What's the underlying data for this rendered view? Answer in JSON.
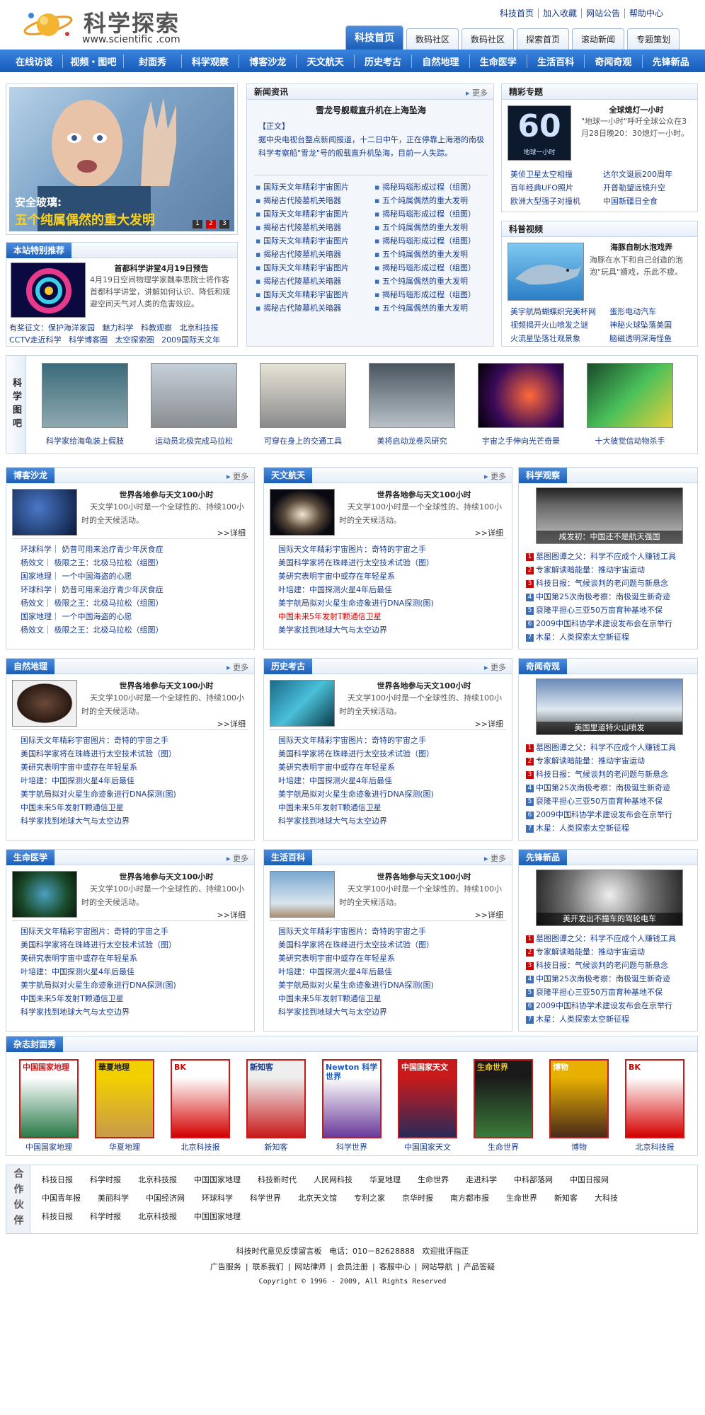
{
  "header": {
    "title": "科学探索",
    "url": "www.scientific .com",
    "toplinks": [
      "科技首页",
      "加入收藏",
      "网站公告",
      "帮助中心"
    ],
    "tabs": [
      "科技首页",
      "数码社区",
      "数码社区",
      "探索首页",
      "滚动新闻",
      "专题策划"
    ]
  },
  "nav": [
    "在线访谈",
    "视频・图吧",
    "封面秀",
    "科学观察",
    "博客沙龙",
    "天文航天",
    "历史考古",
    "自然地理",
    "生命医学",
    "生活百科",
    "奇闻奇观",
    "先锋新品"
  ],
  "hero": {
    "line1": "安全玻璃:",
    "line2": "五个纯属偶然的重大发明",
    "pages": [
      "1",
      "2",
      "3"
    ]
  },
  "recommend": {
    "title": "本站特别推荐",
    "headline": "首都科学讲堂4月19日预告",
    "desc": "4月19日空间物理学家魏奉思院士将作客首都科学讲堂，讲解如何认识、降低和规避空间天气对人类的危害效应。",
    "links": [
      "有奖征文：保护海洋家园",
      "魅力科学",
      "科教观察",
      "北京科技报",
      "CCTV走近科学",
      "科学博客圈",
      "太空探索圈",
      "2009国际天文年"
    ]
  },
  "news": {
    "title": "新闻资讯",
    "more": "更多",
    "headline": "雪龙号舰载直升机在上海坠海",
    "tag": "【正文】",
    "body": "据中央电视台整点新闻报道，十二日中午，正在停靠上海港的南极科学考察船\"雪龙\"号的舰载直升机坠海，目前一人失踪。",
    "left": [
      "国际天文年精彩宇宙图片",
      "揭秘古代陵墓机关暗器",
      "国际天文年精彩宇宙图片",
      "揭秘古代陵墓机关暗器",
      "国际天文年精彩宇宙图片",
      "揭秘古代陵墓机关暗器",
      "国际天文年精彩宇宙图片",
      "揭秘古代陵墓机关暗器",
      "国际天文年精彩宇宙图片",
      "揭秘古代陵墓机关暗器"
    ],
    "right": [
      "揭秘玛瑙形成过程（组图）",
      "五个纯属偶然的重大发明",
      "揭秘玛瑙形成过程（组图）",
      "五个纯属偶然的重大发明",
      "揭秘玛瑙形成过程（组图）",
      "五个纯属偶然的重大发明",
      "揭秘玛瑙形成过程（组图）",
      "五个纯属偶然的重大发明",
      "揭秘玛瑙形成过程（组图）",
      "五个纯属偶然的重大发明"
    ]
  },
  "special": {
    "title": "精彩专题",
    "img_text": "60",
    "img_sub": "地球一小时",
    "headline": "全球熄灯一小时",
    "desc": "\"地球一小时\"呼吁全球公众在3月28日晚20：30熄灯一小时。",
    "links": [
      "美侦卫星太空相撞",
      "达尔文诞辰200周年",
      "百年经典UFO照片",
      "开普勒望远镜升空",
      "欧洲大型强子对撞机",
      "中国新疆日全食"
    ]
  },
  "video": {
    "title": "科普视频",
    "headline": "海豚自制水泡戏弄",
    "desc": "海豚在水下和自己创造的泡泡\"玩具\"嬉戏，乐此不疲。",
    "links": [
      "美宇航局蝴蝶织完美杯网",
      "蛋形电动汽车",
      "视频揭开火山喷发之谜",
      "神秘火球坠落美国",
      "火流星坠落壮观景象",
      "脑磁透明深海怪鱼"
    ]
  },
  "gallery": {
    "label": "科学图吧",
    "items": [
      "科学家给海龟装上假肢",
      "运动员北极完成马拉松",
      "可穿在身上的交通工具",
      "美将启动龙卷风研究",
      "宇宙之手伸向光芒奇景",
      "十大彼觉信动物杀手"
    ]
  },
  "sections": [
    {
      "title": "博客沙龙",
      "more": "更多",
      "headline": "世界各地参与天文100小时",
      "desc": "天文学100小时是一个全球性的、持续100小时的全天候活动。",
      "detail": ">>详细",
      "links": [
        "环球科学｜ 奶昔可用来治疗青少年厌食症",
        "杨效文｜ 极限之王：北极马拉松（组图）",
        "国家地理｜ 一个中国海盗的心愿",
        "环球科学｜ 奶昔可用来治疗青少年厌食症",
        "杨效文｜ 极限之王：北极马拉松（组图）",
        "国家地理｜ 一个中国海盗的心愿",
        "杨效文｜ 极限之王：北极马拉松（组图）"
      ]
    },
    {
      "title": "天文航天",
      "more": "更多",
      "headline": "世界各地参与天文100小时",
      "desc": "天文学100小时是一个全球性的、持续100小时的全天候活动。",
      "detail": ">>详细",
      "links": [
        "国际天文年精彩宇宙图片：奇特的宇宙之手",
        "美国科学家将在珠峰进行太空技术试验（图）",
        "美研究表明宇宙中或存在年轻星系",
        "叶培建：中国探测火星4年后最佳",
        "美宇航局拟对火星生命迹象进行DNA探测(图)",
        "中国未来5年发射T颗通信卫星",
        "美学家找到地球大气与太空边界"
      ]
    },
    {
      "title": "自然地理",
      "more": "更多",
      "headline": "世界各地参与天文100小时",
      "desc": "天文学100小时是一个全球性的、持续100小时的全天候活动。",
      "detail": ">>详细",
      "links": [
        "国际天文年精彩宇宙图片：奇特的宇宙之手",
        "美国科学家将在珠峰进行太空技术试验（图）",
        "美研究表明宇宙中或存在年轻星系",
        "叶培建：中国探测火星4年后最佳",
        "美宇航局拟对火星生命迹象进行DNA探测(图)",
        "中国未来5年发射T颗通信卫星",
        "科学家找到地球大气与太空边界"
      ]
    },
    {
      "title": "历史考古",
      "more": "更多",
      "headline": "世界各地参与天文100小时",
      "desc": "天文学100小时是一个全球性的、持续100小时的全天候活动。",
      "detail": ">>详细",
      "links": [
        "国际天文年精彩宇宙图片：奇特的宇宙之手",
        "美国科学家将在珠峰进行太空技术试验（图）",
        "美研究表明宇宙中或存在年轻星系",
        "叶培建：中国探测火星4年后最佳",
        "美宇航局拟对火星生命迹象进行DNA探测(图)",
        "中国未来5年发射T颗通信卫星",
        "科学家找到地球大气与太空边界"
      ]
    },
    {
      "title": "生命医学",
      "more": "更多",
      "headline": "世界各地参与天文100小时",
      "desc": "天文学100小时是一个全球性的、持续100小时的全天候活动。",
      "detail": ">>详细",
      "links": [
        "国际天文年精彩宇宙图片：奇特的宇宙之手",
        "美国科学家将在珠峰进行太空技术试验（图）",
        "美研究表明宇宙中或存在年轻星系",
        "叶培建：中国探测火星4年后最佳",
        "美宇航局拟对火星生命迹象进行DNA探测(图)",
        "中国未来5年发射T颗通信卫星",
        "科学家找到地球大气与太空边界"
      ]
    },
    {
      "title": "生活百科",
      "more": "更多",
      "headline": "世界各地参与天文100小时",
      "desc": "天文学100小时是一个全球性的、持续100小时的全天候活动。",
      "detail": ">>详细",
      "links": [
        "国际天文年精彩宇宙图片：奇特的宇宙之手",
        "美国科学家将在珠峰进行太空技术试验（图）",
        "美研究表明宇宙中或存在年轻星系",
        "叶培建：中国探测火星4年后最佳",
        "美宇航局拟对火星生命迹象进行DNA探测(图)",
        "中国未来5年发射T颗通信卫星",
        "科学家找到地球大气与太空边界"
      ]
    }
  ],
  "rightcols": [
    {
      "title": "科学观察",
      "caption": "咸发初：中国还不是航天强国"
    },
    {
      "title": "奇闻奇观",
      "caption": "美国里道特火山喷发"
    },
    {
      "title": "先锋新品",
      "caption": "美开发出不撞车的驾轮电车"
    }
  ],
  "ranked": [
    "墓图图谭之父：科学不应成个人赚钱工具",
    "专家解读暗能量：推动宇宙运动",
    "科技日报：气候谈判的老问题与新悬念",
    "中国第25次南极考察：南极诞生新奇迹",
    "裒隆平担心三亚50万亩育种基地不保",
    "2009中国科协学术建设发布会在京举行",
    "木星：人类探索太空新征程"
  ],
  "magazines": {
    "title": "杂志封面秀",
    "items": [
      "中国国家地理",
      "华夏地理",
      "北京科技报",
      "新知客",
      "科学世界",
      "中国国家天文",
      "生命世界",
      "博物",
      "北京科技报"
    ],
    "covers": [
      "中国国家地理",
      "華夏地理",
      "BK",
      "新知客",
      "Newton 科学世界",
      "中国国家天文",
      "生命世界",
      "博物",
      "BK"
    ]
  },
  "partners": {
    "label": "合作伙伴",
    "rows": [
      [
        "科技日报",
        "科学时报",
        "北京科技报",
        "中国国家地理",
        "科技新时代",
        "人民网科技",
        "华夏地理",
        "生命世界",
        "走进科学",
        "中科部落网",
        "中国日报网"
      ],
      [
        "中国青年报",
        "美丽科学",
        "中国经济网",
        "环球科学",
        "科学世界",
        "北京天文馆",
        "专利之家",
        "京华时报",
        "南方都市报",
        "生命世界",
        "新知客",
        "大科技"
      ],
      [
        "科技日报",
        "科学时报",
        "北京科技报",
        "中国国家地理"
      ]
    ]
  },
  "footer": {
    "line1": "科技时代意见反馈留言板   电话：010－82628888   欢迎批评指正",
    "links": [
      "广告服务",
      "联系我们",
      "网站律师",
      "会员注册",
      "客服中心",
      "网站导航",
      "产品答疑"
    ],
    "copyright": "Copyright © 1996 - 2009, All Rights Reserved"
  },
  "colors": {
    "brand": "#1c5fb8",
    "link": "#1a3c8e",
    "red": "#d40000"
  }
}
